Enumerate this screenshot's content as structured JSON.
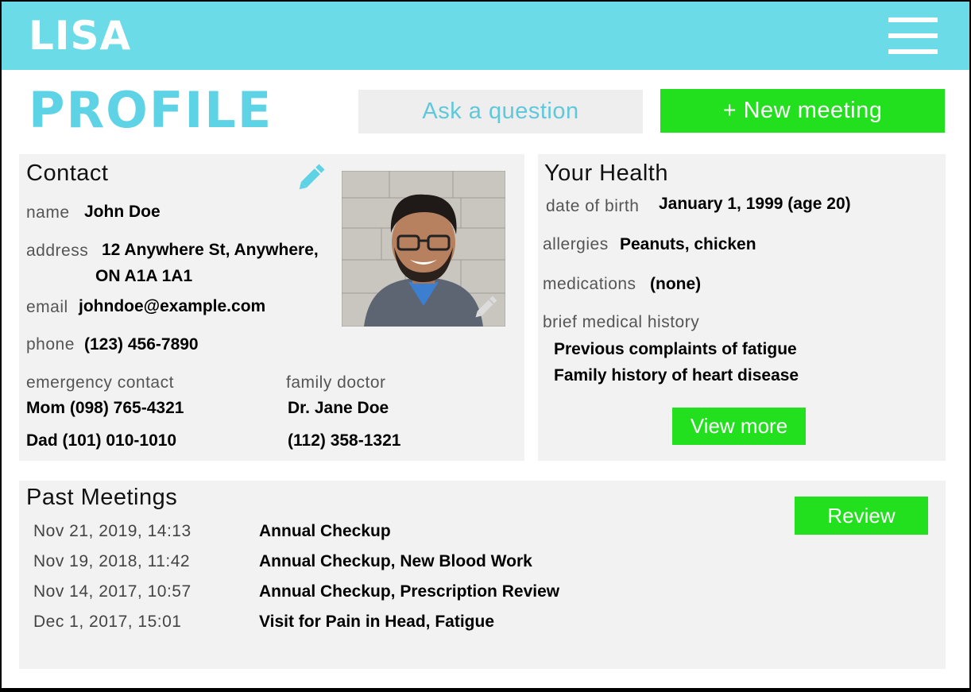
{
  "header": {
    "app_name": "LISA",
    "menu_icon": "hamburger-menu-icon"
  },
  "page": {
    "title": "PROFILE"
  },
  "actions": {
    "ask_question": "Ask a question",
    "new_meeting": "+ New meeting"
  },
  "contact": {
    "title": "Contact",
    "name_label": "name",
    "name": "John Doe",
    "address_label": "address",
    "address_line1": "12 Anywhere St, Anywhere,",
    "address_line2": "ON A1A 1A1",
    "email_label": "email",
    "email": "johndoe@example.com",
    "phone_label": "phone",
    "phone": "(123) 456-7890",
    "emergency_label": "emergency contact",
    "emergency_1": "Mom (098) 765-4321",
    "emergency_2": "Dad (101) 010-1010",
    "doctor_label": "family doctor",
    "doctor_name": "Dr. Jane Doe",
    "doctor_phone": "(112) 358-1321"
  },
  "health": {
    "title": "Your Health",
    "dob_label": "date of birth",
    "dob": "January 1, 1999 (age 20)",
    "allergies_label": "allergies",
    "allergies": "Peanuts, chicken",
    "medications_label": "medications",
    "medications": "(none)",
    "history_label": "brief medical history",
    "history_1": "Previous complaints of fatigue",
    "history_2": "Family history of heart disease",
    "view_more": "View more"
  },
  "meetings": {
    "title": "Past Meetings",
    "review": "Review",
    "rows": [
      {
        "date": "Nov 21, 2019, 14:13",
        "title": "Annual Checkup"
      },
      {
        "date": "Nov 19, 2018, 11:42",
        "title": "Annual Checkup, New Blood Work"
      },
      {
        "date": "Nov 14, 2017, 10:57",
        "title": "Annual Checkup, Prescription Review"
      },
      {
        "date": "Dec 1, 2017, 15:01",
        "title": "Visit for Pain in Head, Fatigue"
      }
    ]
  },
  "colors": {
    "header_bg": "#6bdbe8",
    "title_accent": "#5fd3e6",
    "action_green": "#22e01e",
    "panel_bg": "#f2f2f2"
  }
}
